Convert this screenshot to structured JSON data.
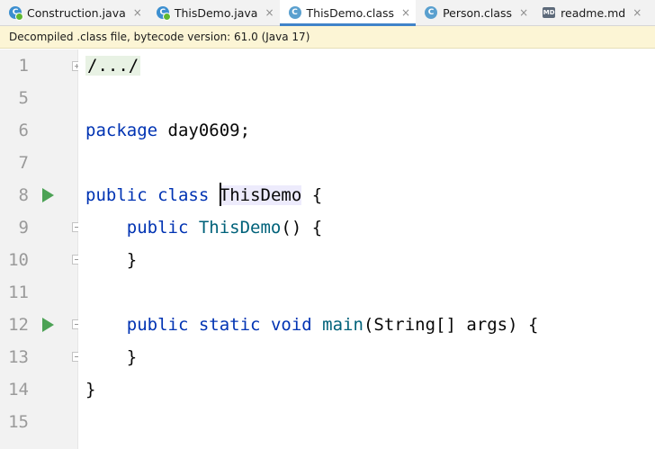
{
  "tabs": [
    {
      "label": "Construction.java",
      "icon": "java-class-icon",
      "active": false
    },
    {
      "label": "ThisDemo.java",
      "icon": "java-class-icon",
      "active": false
    },
    {
      "label": "ThisDemo.class",
      "icon": "class-file-icon",
      "active": true
    },
    {
      "label": "Person.class",
      "icon": "class-file-icon",
      "active": false
    },
    {
      "label": "readme.md",
      "icon": "markdown-icon",
      "active": false
    }
  ],
  "tab_close": "×",
  "icon_glyphs": {
    "class": "C",
    "md": "MD"
  },
  "banner": "Decompiled .class file, bytecode version: 61.0 (Java 17)",
  "line_numbers": [
    "1",
    "5",
    "6",
    "7",
    "8",
    "9",
    "10",
    "11",
    "12",
    "13",
    "14",
    "15"
  ],
  "code": {
    "l1": "/.../",
    "l6_kw": "package",
    "l6_rest": " day0609;",
    "l8_kw1": "public",
    "l8_kw2": "class",
    "l8_name": "ThisDemo",
    "l8_rest": " {",
    "l9_kw": "public",
    "l9_name": "ThisDemo",
    "l9_rest": "() {",
    "l10": "}",
    "l12_kw1": "public",
    "l12_kw2": "static",
    "l12_kw3": "void",
    "l12_name": "main",
    "l12_rest": "(String[] args) {",
    "l13": "}",
    "l14": "}"
  },
  "colors": {
    "keyword": "#0033b3",
    "method": "#00627a",
    "accent": "#4083c9",
    "run": "#4ca255"
  }
}
